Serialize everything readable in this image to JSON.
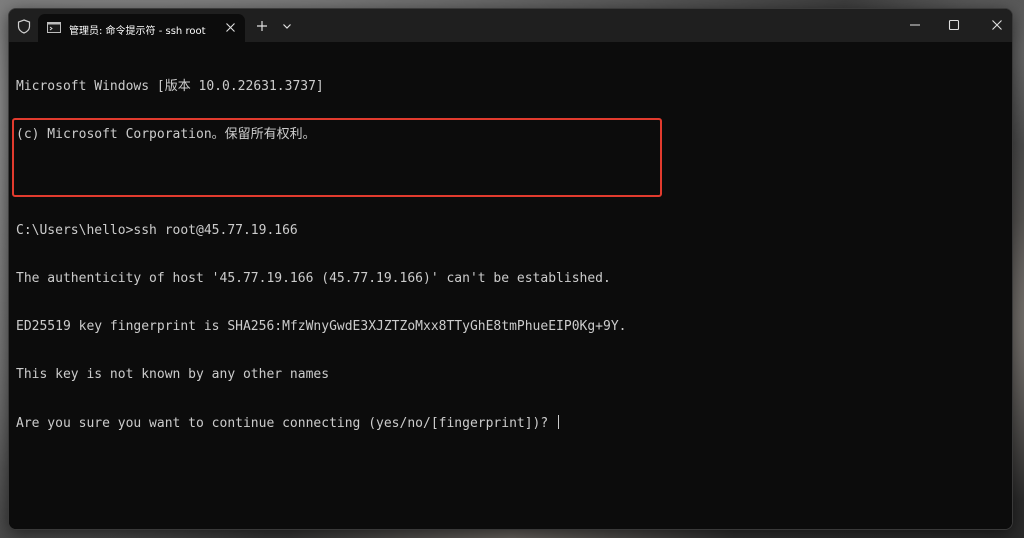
{
  "window": {
    "tab_title": "管理员: 命令提示符 - ssh  root"
  },
  "terminal": {
    "lines": [
      "Microsoft Windows [版本 10.0.22631.3737]",
      "(c) Microsoft Corporation。保留所有权利。",
      "",
      "C:\\Users\\hello>ssh root@45.77.19.166",
      "The authenticity of host '45.77.19.166 (45.77.19.166)' can't be established.",
      "ED25519 key fingerprint is SHA256:MfzWnyGwdE3XJZTZoMxx8TTyGhE8tmPhueEIP0Kg+9Y.",
      "This key is not known by any other names",
      "Are you sure you want to continue connecting (yes/no/[fingerprint])? "
    ]
  },
  "colors": {
    "terminal_bg": "#0c0c0c",
    "titlebar_bg": "#1f1f1f",
    "text": "#cccccc",
    "highlight": "#e23b2e"
  },
  "icons": {
    "shield": "shield-icon",
    "tab": "terminal-icon",
    "tab_close": "close-icon",
    "new_tab": "plus-icon",
    "dropdown": "chevron-down-icon",
    "minimize": "minimize-icon",
    "maximize": "maximize-icon",
    "close": "close-icon"
  }
}
